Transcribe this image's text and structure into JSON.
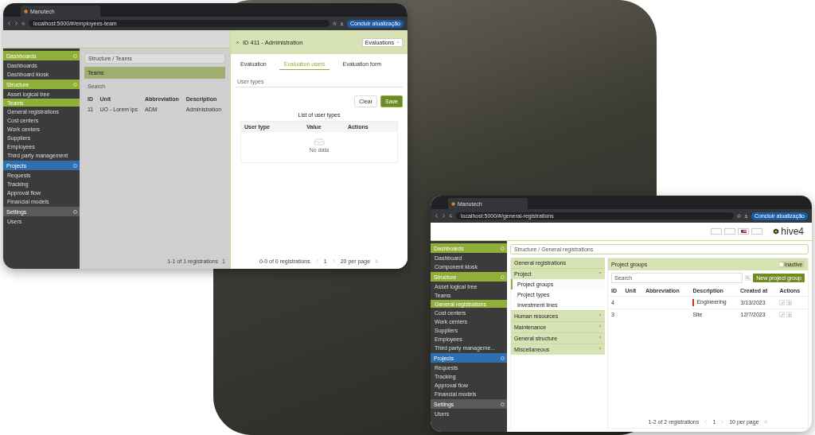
{
  "left_window": {
    "tab_title": "Manutech",
    "url": "localhost:5000/#/employees-team",
    "update_button": "Concluir atualização",
    "sidebar": [
      {
        "title": "Dashboards",
        "color": "#8fae3a",
        "items": [
          {
            "label": "Dashboards",
            "selected": false
          },
          {
            "label": "Dashboard kiosk",
            "selected": false
          }
        ]
      },
      {
        "title": "Structure",
        "color": "#8fae3a",
        "items": [
          {
            "label": "Asset logical tree",
            "selected": false
          },
          {
            "label": "Teams",
            "selected": true
          },
          {
            "label": "General registrations",
            "selected": false
          },
          {
            "label": "Cost centers",
            "selected": false
          },
          {
            "label": "Work centers",
            "selected": false
          },
          {
            "label": "Suppliers",
            "selected": false
          },
          {
            "label": "Employees",
            "selected": false
          },
          {
            "label": "Third party management",
            "selected": false
          }
        ]
      },
      {
        "title": "Projects",
        "color": "#2f6fb0",
        "items": [
          {
            "label": "Requests",
            "selected": false
          },
          {
            "label": "Tracking",
            "selected": false
          },
          {
            "label": "Approval flow",
            "selected": false
          },
          {
            "label": "Financial models",
            "selected": false
          }
        ]
      },
      {
        "title": "Settings",
        "color": "#5a5a5a",
        "items": [
          {
            "label": "Users",
            "selected": false
          }
        ]
      }
    ],
    "breadcrumb": "Structure / Teams",
    "panel_title": "Teams",
    "search_placeholder": "Search",
    "columns": [
      "ID",
      "Unit",
      "Abbreviation",
      "Description"
    ],
    "rows": [
      [
        "11",
        "UO - Lorem ips",
        "ADM",
        "Administration"
      ]
    ],
    "footer": {
      "summary": "1-1 of 1 registrations",
      "page": "1"
    },
    "drawer": {
      "title": "ID 411 - Administration",
      "select": "Evaluations",
      "tabs": [
        {
          "label": "Evaluation",
          "selected": false
        },
        {
          "label": "Evaluation users",
          "selected": true
        },
        {
          "label": "Evaluation form",
          "selected": false
        }
      ],
      "field_placeholder": "User types",
      "buttons": [
        {
          "label": "Clear",
          "kind": "secondary"
        },
        {
          "label": "Save",
          "kind": "primary"
        }
      ],
      "list_title": "List of user types",
      "columns": [
        "User type",
        "Value",
        "Actions"
      ],
      "empty_text": "No data",
      "footer": {
        "summary": "0-0 of 0 registrations",
        "page": "1",
        "per_page": "20 per page"
      }
    }
  },
  "right_window": {
    "tab_title": "Manutech",
    "url": "localhost:5000/#/general-registrations",
    "update_button": "Concluir atualização",
    "logo": "hive4",
    "sidebar": [
      {
        "title": "Dashboards",
        "color": "#8fae3a",
        "items": [
          {
            "label": "Dashboard",
            "selected": false
          },
          {
            "label": "Component kiosk",
            "selected": false
          }
        ]
      },
      {
        "title": "Structure",
        "color": "#8fae3a",
        "items": [
          {
            "label": "Asset logical tree",
            "selected": false
          },
          {
            "label": "Teams",
            "selected": false
          },
          {
            "label": "General registrations",
            "selected": true
          },
          {
            "label": "Cost centers",
            "selected": false
          },
          {
            "label": "Work centers",
            "selected": false
          },
          {
            "label": "Suppliers",
            "selected": false
          },
          {
            "label": "Employees",
            "selected": false
          },
          {
            "label": "Third party manageme...",
            "selected": false
          }
        ]
      },
      {
        "title": "Projects",
        "color": "#2f6fb0",
        "items": [
          {
            "label": "Requests",
            "selected": false
          },
          {
            "label": "Tracking",
            "selected": false
          },
          {
            "label": "Approval flow",
            "selected": false
          },
          {
            "label": "Financial models",
            "selected": false
          }
        ]
      },
      {
        "title": "Settings",
        "color": "#5a5a5a",
        "items": [
          {
            "label": "Users",
            "selected": false
          }
        ]
      }
    ],
    "breadcrumb": "Structure / General registrations",
    "menu_title": "General registrations",
    "menu": [
      {
        "label": "Project",
        "expanded": true,
        "children": [
          {
            "label": "Project groups",
            "selected": true
          },
          {
            "label": "Project types",
            "selected": false
          },
          {
            "label": "Investment lines",
            "selected": false
          }
        ]
      },
      {
        "label": "Human resources",
        "expanded": false
      },
      {
        "label": "Maintenance",
        "expanded": false
      },
      {
        "label": "General structure",
        "expanded": false
      },
      {
        "label": "Miscellaneous",
        "expanded": false
      }
    ],
    "panel_title": "Project groups",
    "toggle": {
      "label": "Inactive",
      "on": false
    },
    "search_placeholder": "Search",
    "new_button": "New project group",
    "columns": [
      "ID",
      "Unit",
      "Abbreviation",
      "Description",
      "Created at",
      "Actions"
    ],
    "rows": [
      {
        "id": "4",
        "description": "Engineering",
        "created": "3/13/2023",
        "color": "#e02424"
      },
      {
        "id": "3",
        "description": "Site",
        "created": "12/7/2023"
      }
    ],
    "footer": {
      "summary": "1-2 of 2 registrations",
      "page": "1",
      "per_page": "10 per page"
    }
  }
}
